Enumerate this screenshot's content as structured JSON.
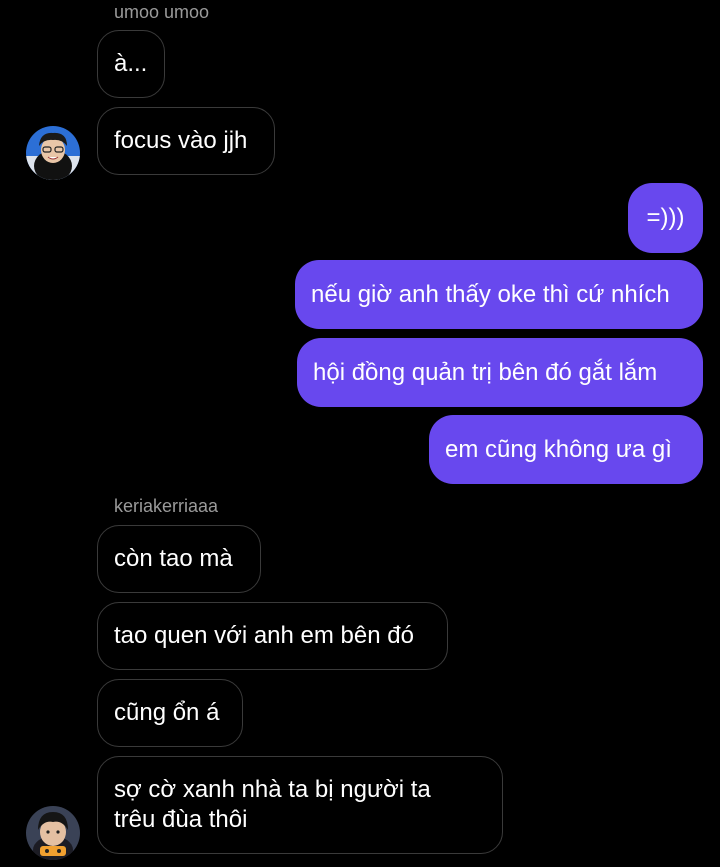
{
  "senders": {
    "first": "umoo umoo",
    "second": "keriakerriaaa"
  },
  "messages": {
    "in1": "à...",
    "in2": "focus vào jjh",
    "out1": "=)))",
    "out2": "nếu giờ anh thấy oke thì cứ nhích",
    "out3": "hội đồng quản trị bên đó gắt lắm",
    "out4": "em cũng không ưa gì",
    "in3": "còn tao mà",
    "in4": "tao quen với anh em bên đó",
    "in5": "cũng ổn á",
    "in6": "sợ cờ xanh nhà ta bị người ta trêu đùa thôi"
  },
  "colors": {
    "outgoing_bubble": "#6848ee",
    "incoming_border": "#3a3a3a",
    "background": "#000000"
  },
  "icons": {
    "avatar1": "user-avatar-photo",
    "avatar2": "user-avatar-photo"
  }
}
